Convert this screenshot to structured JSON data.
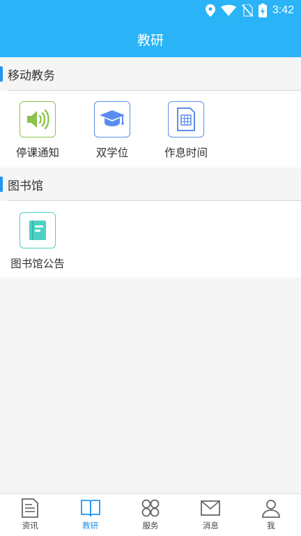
{
  "status_bar": {
    "time": "3:42",
    "icons": [
      "location-icon",
      "wifi-icon",
      "no-sim-icon",
      "battery-charging-icon"
    ]
  },
  "header": {
    "title": "教研"
  },
  "sections": [
    {
      "title": "移动教务",
      "items": [
        {
          "label": "停课通知",
          "icon": "speaker-icon",
          "color": "#8bc34a"
        },
        {
          "label": "双学位",
          "icon": "graduation-cap-icon",
          "color": "#5b8def"
        },
        {
          "label": "作息时间",
          "icon": "timetable-icon",
          "color": "#5b8def"
        }
      ]
    },
    {
      "title": "图书馆",
      "items": [
        {
          "label": "图书馆公告",
          "icon": "book-icon",
          "color": "#4dd0c4"
        }
      ]
    }
  ],
  "tabbar": {
    "active": "教研",
    "tabs": [
      {
        "label": "资讯",
        "icon": "news-icon"
      },
      {
        "label": "教研",
        "icon": "open-book-icon"
      },
      {
        "label": "服务",
        "icon": "services-icon"
      },
      {
        "label": "消息",
        "icon": "mail-icon"
      },
      {
        "label": "我",
        "icon": "person-icon"
      }
    ]
  },
  "colors": {
    "primary": "#2bb3f7",
    "accent": "#2196f3",
    "background": "#f5f5f5"
  }
}
